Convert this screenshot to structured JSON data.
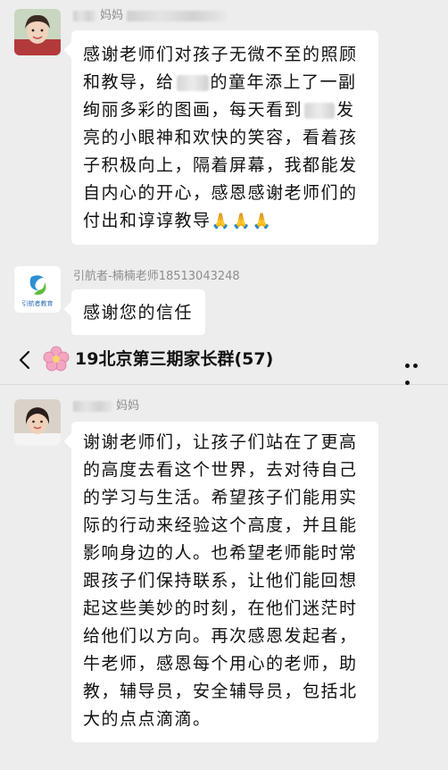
{
  "messages_top": [
    {
      "sender_suffix": "妈妈",
      "text_parts": [
        "感谢老师们对孩子无微不至的照顾和教导，给",
        "的童年添上了一副绚丽多彩的图画，每天看到",
        "发亮的小眼神和欢快的笑容，看着孩子积极向上，隔着屏幕，我都能发自内心的开心，感恩感谢老师们的付出和谆谆教导"
      ],
      "emoji": "🙏🙏🙏"
    },
    {
      "sender": "引航者-楠楠老师18513043248",
      "avatar_text": "引航者教育",
      "text": "感谢您的信任"
    }
  ],
  "title_bar": {
    "group_name": "19北京第三期家长群(57)",
    "group_emoji": "🌸"
  },
  "messages_bottom": [
    {
      "sender_suffix": "妈妈",
      "text": "谢谢老师们，让孩子们站在了更高的高度去看这个世界，去对待自己的学习与生活。希望孩子们能用实际的行动来经验这个高度，并且能影响身边的人。也希望老师能时常跟孩子们保持联系，让他们能回想起这些美妙的时刻，在他们迷茫时给他们以方向。再次感恩发起者，牛老师，感恩每个用心的老师，助教，辅导员，安全辅导员，包括北大的点点滴滴。"
    }
  ],
  "colors": {
    "chat_background": "#ededed",
    "bubble": "#ffffff",
    "sender_text": "#8d8d8d"
  }
}
